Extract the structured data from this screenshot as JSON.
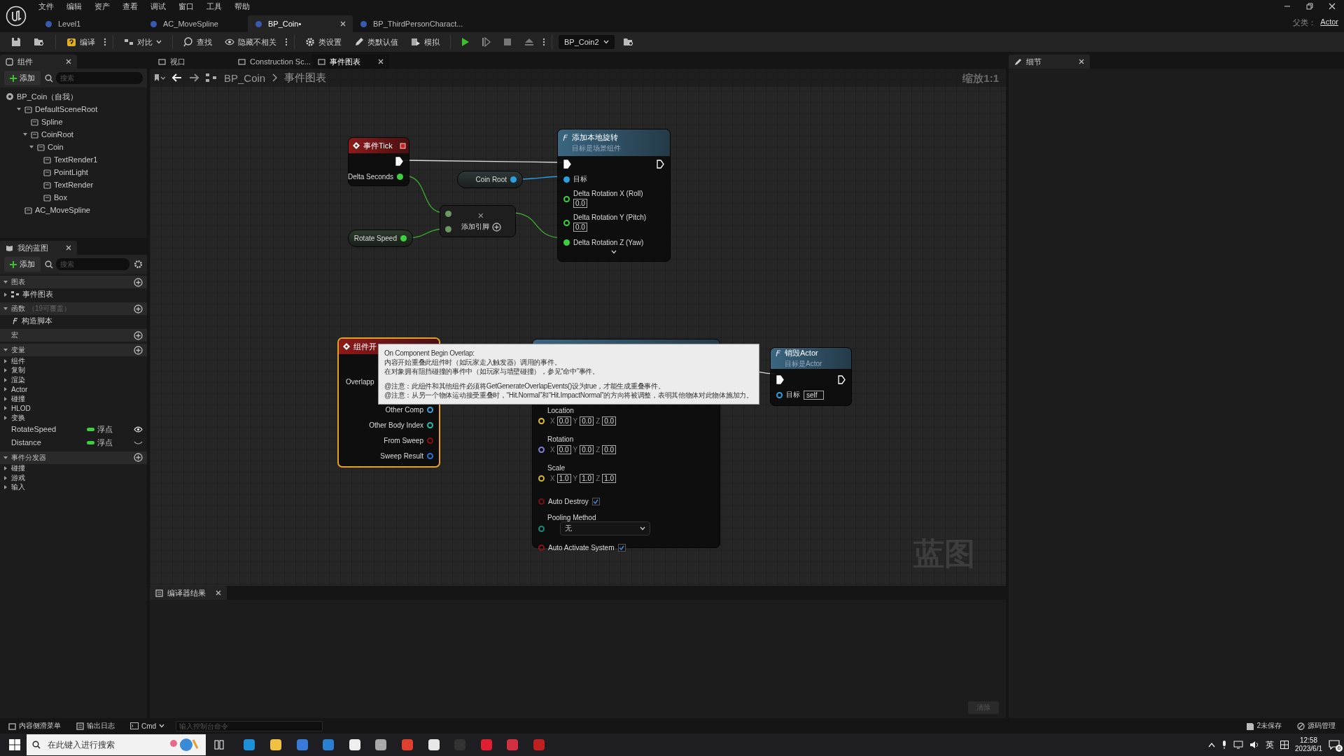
{
  "menu": [
    "文件",
    "编辑",
    "资产",
    "查看",
    "调试",
    "窗口",
    "工具",
    "帮助"
  ],
  "doc_tabs": [
    {
      "label": "Level1",
      "selected": false
    },
    {
      "label": "AC_MoveSpline",
      "selected": false
    },
    {
      "label": "BP_Coin•",
      "selected": true
    },
    {
      "label": "BP_ThirdPersonCharact...",
      "selected": false
    }
  ],
  "parent_class": {
    "label": "父类：",
    "value": "Actor"
  },
  "toolbar": {
    "compile": "编译",
    "diff": "对比",
    "find": "查找",
    "hide_unrelated": "隐藏不相关",
    "class_settings": "类设置",
    "class_defaults": "类默认值",
    "simulate": "模拟",
    "debug_object": "BP_Coin2"
  },
  "components": {
    "title": "组件",
    "add": "添加",
    "search_placeholder": "搜索",
    "self": "BP_Coin（自我）",
    "tree": [
      {
        "label": "DefaultSceneRoot",
        "expanded": true,
        "children": [
          {
            "label": "Spline"
          },
          {
            "label": "CoinRoot",
            "expanded": true,
            "children": [
              {
                "label": "Coin",
                "expanded": true,
                "children": [
                  {
                    "label": "TextRender1"
                  },
                  {
                    "label": "PointLight"
                  },
                  {
                    "label": "TextRender"
                  },
                  {
                    "label": "Box"
                  }
                ]
              }
            ]
          }
        ]
      },
      {
        "label": "AC_MoveSpline"
      }
    ]
  },
  "my_blueprint": {
    "title": "我的蓝图",
    "add": "添加",
    "search_placeholder": "搜索",
    "sections": [
      {
        "title": "图表",
        "expanded": true,
        "items": [
          {
            "kind": "graph",
            "label": "事件图表",
            "expanded": false
          }
        ]
      },
      {
        "title": "函数",
        "note": "（19可覆盖）",
        "expanded": true,
        "items": [
          {
            "kind": "function",
            "label": "构造脚本"
          }
        ]
      },
      {
        "title": "宏"
      },
      {
        "title": "变量",
        "expanded": true,
        "items": [
          {
            "kind": "category",
            "label": "组件",
            "expanded": false
          },
          {
            "kind": "category",
            "label": "复制",
            "expanded": false
          },
          {
            "kind": "category",
            "label": "渲染",
            "expanded": false
          },
          {
            "kind": "category",
            "label": "Actor",
            "expanded": false
          },
          {
            "kind": "category",
            "label": "碰撞",
            "expanded": false
          },
          {
            "kind": "category",
            "label": "HLOD",
            "expanded": false
          },
          {
            "kind": "category",
            "label": "变换",
            "expanded": false
          },
          {
            "kind": "variable",
            "label": "RotateSpeed",
            "type": "浮点",
            "visible": true
          },
          {
            "kind": "variable",
            "label": "Distance",
            "type": "浮点",
            "visible": false
          }
        ]
      },
      {
        "title": "事件分发器",
        "expanded": true,
        "items": [
          {
            "kind": "category",
            "label": "碰撞",
            "expanded": false
          },
          {
            "kind": "category",
            "label": "游戏",
            "expanded": false
          },
          {
            "kind": "category",
            "label": "输入",
            "expanded": false
          }
        ]
      }
    ]
  },
  "graph_tabs": [
    {
      "label": "视口",
      "selected": false
    },
    {
      "label": "Construction Sc...",
      "selected": false
    },
    {
      "label": "事件图表",
      "selected": true
    }
  ],
  "breadcrumb": [
    "BP_Coin",
    "事件图表"
  ],
  "graph": {
    "zoom": "缩放1:1",
    "watermark": "蓝图",
    "event_tick": {
      "title": "事件Tick",
      "output": "Delta Seconds"
    },
    "coin_root": {
      "label": "Coin Root"
    },
    "rotate_speed": {
      "label": "Rotate Speed"
    },
    "multiply": {
      "symbol": "×",
      "add_pin": "添加引脚"
    },
    "add_rotation": {
      "title": "添加本地旋转",
      "subtitle": "目标是场景组件",
      "target": "目标",
      "inputs": [
        {
          "label": "Delta Rotation X (Roll)",
          "value": "0.0",
          "connected": false
        },
        {
          "label": "Delta Rotation Y (Pitch)",
          "value": "0.0",
          "connected": false
        },
        {
          "label": "Delta Rotation Z (Yaw)",
          "connected": true
        }
      ]
    },
    "overlap_event": {
      "title": "组件开",
      "selected": true,
      "first_pin": "Overlapp",
      "pins": [
        {
          "label": "Other Comp",
          "color": "#3aa0d8"
        },
        {
          "label": "Other Body Index",
          "color": "#20c0a0"
        },
        {
          "label": "From Sweep",
          "color": "#8a1010"
        },
        {
          "label": "Sweep Result",
          "color": "#3070d0"
        }
      ]
    },
    "spawn_system": {
      "pins": [
        {
          "kind": "vector",
          "label": "Location",
          "color": "#e0c020",
          "values": [
            {
              "axis": "X",
              "value": "0.0"
            },
            {
              "axis": "Y",
              "value": "0.0"
            },
            {
              "axis": "Z",
              "value": "0.0"
            }
          ]
        },
        {
          "kind": "vector",
          "label": "Rotation",
          "color": "#8080d0",
          "values": [
            {
              "axis": "X",
              "value": "0.0"
            },
            {
              "axis": "Y",
              "value": "0.0"
            },
            {
              "axis": "Z",
              "value": "0.0"
            }
          ]
        },
        {
          "kind": "vector",
          "label": "Scale",
          "color": "#d8b820",
          "values": [
            {
              "axis": "X",
              "value": "1.0"
            },
            {
              "axis": "Y",
              "value": "1.0"
            },
            {
              "axis": "Z",
              "value": "1.0"
            }
          ]
        },
        {
          "kind": "bool",
          "label": "Auto Destroy",
          "color": "#7a1212",
          "checked": true
        },
        {
          "kind": "enum",
          "label": "Pooling Method",
          "color": "#1a8a7a",
          "value": "无"
        },
        {
          "kind": "bool",
          "label": "Auto Activate System",
          "color": "#8a1414",
          "checked": true
        }
      ]
    },
    "destroy_actor": {
      "title": "销毁Actor",
      "subtitle": "目标是Actor",
      "target": "目标",
      "target_value": "self"
    },
    "tooltip": {
      "paragraphs": [
        [
          "On Component Begin Overlap:",
          "内容开始重叠此组件时（如玩家走入触发器）调用的事件。",
          "在对象拥有阻挡碰撞的事件中（如玩家与墙壁碰撞），参见“命中”事件。"
        ],
        [
          "@注意：此组件和其他组件必须将GetGenerateOverlapEvents()设为true，才能生成重叠事件。",
          "@注意：从另一个物体运动接受重叠时，“Hit.Normal”和“Hit.ImpactNormal”的方向将被调整，表明其他物体对此物体施加力。"
        ]
      ]
    }
  },
  "details": {
    "title": "细节"
  },
  "compiler": {
    "title": "编译器结果",
    "clear": "清除"
  },
  "status_bar": {
    "content_drawer": "内容侧滑菜单",
    "output_log": "输出日志",
    "cmd": "Cmd",
    "console_placeholder": "输入控制台命令",
    "unsaved": "2未保存",
    "source_control": "源码管理"
  },
  "taskbar": {
    "search_placeholder": "在此键入进行搜索",
    "ime": "英",
    "time": "12:58",
    "date": "2023/6/1",
    "notifications": "6"
  }
}
